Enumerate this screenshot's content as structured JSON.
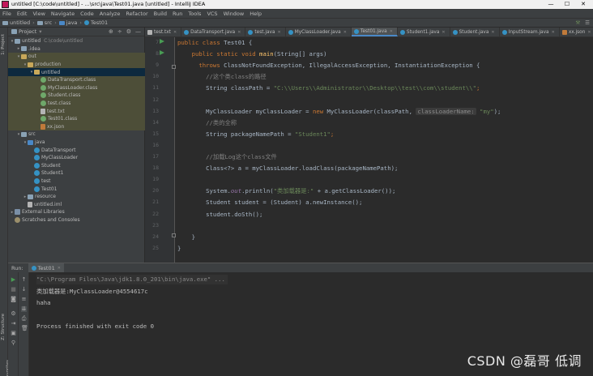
{
  "window": {
    "title": "untitled [C:\\code\\untitled] - ...\\src\\java\\Test01.java [untitled] - IntelliJ IDEA",
    "controls": [
      "—",
      "☐",
      "✕"
    ]
  },
  "menu": [
    "File",
    "Edit",
    "View",
    "Navigate",
    "Code",
    "Analyze",
    "Refactor",
    "Build",
    "Run",
    "Tools",
    "VCS",
    "Window",
    "Help"
  ],
  "breadcrumb": [
    "untitled",
    "src",
    "java",
    "Test01"
  ],
  "project_panel": {
    "header": "Project",
    "tree": [
      {
        "label": "untitled",
        "suffix": "C:\\code\\untitled",
        "icon": "folder",
        "level": 0,
        "tw": "▾"
      },
      {
        "label": ".idea",
        "icon": "folder",
        "level": 1,
        "tw": "▸"
      },
      {
        "label": "out",
        "icon": "folder-y",
        "level": 1,
        "tw": "▾",
        "hl": true
      },
      {
        "label": "production",
        "icon": "folder-y",
        "level": 2,
        "tw": "▾",
        "hl": true
      },
      {
        "label": "untitled",
        "icon": "folder-y",
        "level": 3,
        "tw": "▾",
        "sel": true
      },
      {
        "label": "DataTransport.class",
        "icon": "cls-f",
        "level": 4,
        "hl": true
      },
      {
        "label": "MyClassLoader.class",
        "icon": "cls-f",
        "level": 4,
        "hl": true
      },
      {
        "label": "Student.class",
        "icon": "cls-f",
        "level": 4,
        "hl": true
      },
      {
        "label": "test.class",
        "icon": "cls-f",
        "level": 4,
        "hl": true
      },
      {
        "label": "test.txt",
        "icon": "file",
        "level": 4,
        "hl": true
      },
      {
        "label": "Test01.class",
        "icon": "cls-f",
        "level": 4,
        "hl": true
      },
      {
        "label": "xx.json",
        "icon": "json",
        "level": 4,
        "hl": true
      },
      {
        "label": "src",
        "icon": "folder",
        "level": 1,
        "tw": "▾"
      },
      {
        "label": "java",
        "icon": "folder-b",
        "level": 2,
        "tw": "▾"
      },
      {
        "label": "DataTransport",
        "icon": "cls",
        "level": 3
      },
      {
        "label": "MyClassLoader",
        "icon": "cls",
        "level": 3
      },
      {
        "label": "Student",
        "icon": "cls",
        "level": 3
      },
      {
        "label": "Student1",
        "icon": "cls",
        "level": 3
      },
      {
        "label": "test",
        "icon": "cls",
        "level": 3
      },
      {
        "label": "Test01",
        "icon": "cls",
        "level": 3
      },
      {
        "label": "resource",
        "icon": "folder",
        "level": 2,
        "tw": "▸"
      },
      {
        "label": "untitled.iml",
        "icon": "file",
        "level": 2
      },
      {
        "label": "External Libraries",
        "icon": "lib",
        "level": 0,
        "tw": "▸"
      },
      {
        "label": "Scratches and Consoles",
        "icon": "scratch",
        "level": 0
      }
    ]
  },
  "tabs": [
    {
      "label": "test.txt",
      "icon": "file"
    },
    {
      "label": "DataTransport.java",
      "icon": "cls"
    },
    {
      "label": "test.java",
      "icon": "cls"
    },
    {
      "label": "MyClassLoader.java",
      "icon": "cls"
    },
    {
      "label": "Test01.java",
      "icon": "cls",
      "active": true
    },
    {
      "label": "Student1.java",
      "icon": "cls"
    },
    {
      "label": "Student.java",
      "icon": "cls"
    },
    {
      "label": "InputStream.java",
      "icon": "cls"
    },
    {
      "label": "xx.json",
      "icon": "json"
    }
  ],
  "editor": {
    "line_numbers": [
      "7",
      "8",
      "9",
      "10",
      "11",
      "12",
      "13",
      "14",
      "15",
      "16",
      "17",
      "18",
      "19",
      "20",
      "21",
      "22",
      "23",
      "24",
      "25"
    ],
    "lines": [
      [
        {
          "t": "public class ",
          "c": "kw"
        },
        {
          "t": "Test01 {",
          "c": "tp"
        }
      ],
      [
        {
          "t": "    public static void ",
          "c": "kw"
        },
        {
          "t": "main",
          "c": "fn"
        },
        {
          "t": "(String[] args)",
          "c": "tp"
        }
      ],
      [
        {
          "t": "      throws ",
          "c": "kw"
        },
        {
          "t": "ClassNotFoundException, IllegalAccessException, InstantiationException {",
          "c": "tp"
        }
      ],
      [
        {
          "t": "        //这个类class的路径",
          "c": "cm"
        }
      ],
      [
        {
          "t": "        String classPath = ",
          "c": "tp"
        },
        {
          "t": "\"C:\\\\Users\\\\Administrator\\\\Desktop\\\\test\\\\com\\\\student\\\\\"",
          "c": "st"
        },
        {
          "t": ";",
          "c": "kw"
        }
      ],
      [],
      [
        {
          "t": "        MyClassLoader myClassLoader = ",
          "c": "tp"
        },
        {
          "t": "new ",
          "c": "kw"
        },
        {
          "t": "MyClassLoader(classPath, ",
          "c": "tp"
        },
        {
          "t": "classLoaderName:",
          "c": "hint"
        },
        {
          "t": " \"my\"",
          "c": "st"
        },
        {
          "t": ");",
          "c": "tp"
        }
      ],
      [
        {
          "t": "        //类的全称",
          "c": "cm"
        }
      ],
      [
        {
          "t": "        String packageNamePath = ",
          "c": "tp"
        },
        {
          "t": "\"Student1\"",
          "c": "st"
        },
        {
          "t": ";",
          "c": "kw"
        }
      ],
      [],
      [
        {
          "t": "        //加载Log这个class文件",
          "c": "cm"
        }
      ],
      [
        {
          "t": "        Class<?> a = myClassLoader.loadClass(packageNamePath);",
          "c": "tp"
        }
      ],
      [],
      [
        {
          "t": "        System.",
          "c": "tp"
        },
        {
          "t": "out",
          "c": "it"
        },
        {
          "t": ".println(",
          "c": "tp"
        },
        {
          "t": "\"类加载器是:\"",
          "c": "st"
        },
        {
          "t": " + a.getClassLoader());",
          "c": "tp"
        }
      ],
      [
        {
          "t": "        Student student = (Student) a.newInstance();",
          "c": "tp"
        }
      ],
      [
        {
          "t": "        student.doSth();",
          "c": "tp"
        }
      ],
      [],
      [
        {
          "t": "    }",
          "c": "tp"
        }
      ],
      [
        {
          "t": "}",
          "c": "tp"
        }
      ]
    ]
  },
  "run_panel": {
    "header": "Run:",
    "tab": "Test01",
    "console": [
      "\"C:\\Program Files\\Java\\jdk1.8.0_201\\bin\\java.exe\" ...",
      "类加载器是:MyClassLoader@4554617c",
      "haha",
      "",
      "Process finished with exit code 0"
    ]
  },
  "left_strip": {
    "project_tab": "1: Project",
    "structure_tab": "Z: Structure",
    "favorites_tab": "2: Favorites"
  },
  "watermark": "CSDN @磊哥 低调"
}
